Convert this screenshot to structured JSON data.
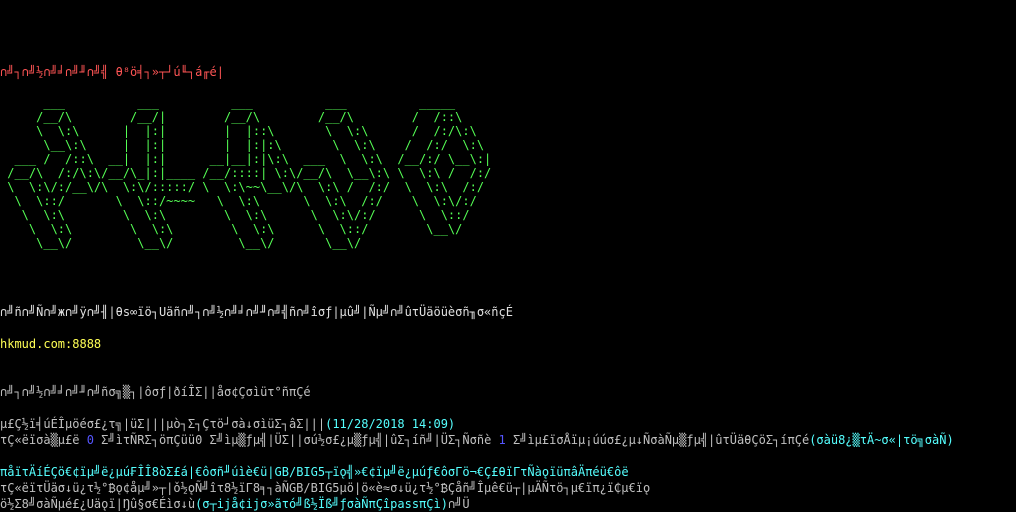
{
  "terminal": {
    "banner": "∩╝┐∩╝½∩╝╛∩╝╜∩╝╣ θ⁸ö╡┐»┬┘ú╙┐á╓é|",
    "logo_ascii": "      ___          ___          ___          ___          _____\n     /__/\\        /__/|        /__/\\        /__/\\        /  /::\\\n     \\  \\:\\      |  |:|        |  |::\\       \\  \\:\\      /  /:/\\:\\\n      \\__\\:\\     |  |:|        |  |:|:\\       \\  \\:\\    /  /:/  \\:\\\n  ___ /  /::\\  __|  |:|      __|__|:|\\:\\  ___  \\  \\:\\  /__/:/ \\__\\:|\n /__/\\  /:/\\:\\/__/\\_|:|____ /__/::::| \\:\\/__/\\  \\__\\:\\ \\  \\:\\ /  /:/\n \\  \\:\\/:/__\\/\\  \\:\\/:::::/ \\  \\:\\~~\\__\\/\\  \\:\\ /  /:/  \\  \\:\\  /:/\n  \\  \\::/       \\  \\::/~~~~   \\  \\:\\      \\  \\:\\  /:/    \\  \\:\\/:/\n   \\  \\:\\        \\  \\:\\        \\  \\:\\      \\  \\:\\/:/      \\  \\::/\n    \\  \\:\\        \\  \\:\\        \\  \\:\\      \\  \\::/        \\__\\/\n     \\__\\/         \\__\\/         \\__\\/       \\__\\/",
    "welcome_line": "∩╝ñ∩╝Ñ∩╝ж∩╝ÿ∩╝╢|θs∞ïö┐Uäñ∩╝┐∩╝½∩╝╛∩╝╜∩╝╣ñ∩╝îσƒ|µû╝|Ñµ╝∩╝ûτÜäöüèσñ╖σ«ñçÉ",
    "host": "hkmud.com:8888",
    "notice": "∩╝┐∩╝½∩╝╛∩╝╜∩╝ñσ╗▒┐|ôσƒ|ðíÎΣ||åσ¢Çσìüτ°ñπÇé",
    "stats_prefix": "µ£Ç½ï╡úÉÎµöéσ£¿τ╗|üΣ|||µò┐Σ┐Çτö┘σà↓σìüΣ┐âΣ|||",
    "stats_date": "(11/28/2018 14:09)",
    "online_prefix": "τÇ«ëïσà▒µ£ë ",
    "online_count": "0",
    "online_mid": " Σ╝ìτÑRΣ┐öπÇüü0 Σ╝ìµ▒ƒµ╣|ÜΣ||σú½σ£¿µ▒ƒµ╣|ûΣ┐íñ╝|ÜΣ┐Ñσñè ",
    "online_count2": "1",
    "online_suffix": " Σ╝ìµ£ïσÅïµ¡úúσ£¿µ↓ÑσàÑµ▒ƒµ╣|ûτÜäθÇöΣ┐íπÇé",
    "online_link": "(σàü8¿▒τÄ~σ«|τö╗σàÑ)",
    "encoding_line": "πåïτÄíÉÇö€¢ïµ╝ë¿µú₣ÎÎ8òΣ£á|€ôσñ╜úìè€ü|GB/BIG5┬ïǫ╣»€¢ïµ╝ë¿µúƒ€ôσΓö¬€Ç£θïΓτÑàǫïüπâÄπéü€ôë",
    "login_line1": "τÇ«ëïτÜäσ↓ü¿τ½°₿ǫ¢åµ╝»┬|ǒ½ǫÑ╝îτ8½ïΓ8╕┐àÑGB/BIG5µö|ö«è≈σ↓ü¿τ½°₿Çåñ╝Îµê€ü┬|µÄÑτö┐µ€ïπ¿ï₵µ€ïǫ",
    "login_line2": "ö½Σ8╝σàÑµé£¿Uäǫï|Ŋû§σ€Éìσ↓ù",
    "login_link": "(σ┬ijå¢ijσ»ãτó╝ß½Ïß╝ƒσàÑπÇîpassπÇì)",
    "login_suffix": "∩╝Ü"
  },
  "colors": {
    "background": "#000000",
    "banner": "#ff5555",
    "logo": "#55ff55",
    "host": "#ffff55",
    "link": "#55ffff",
    "text": "#c0c0c0",
    "count": "#5555ff"
  }
}
